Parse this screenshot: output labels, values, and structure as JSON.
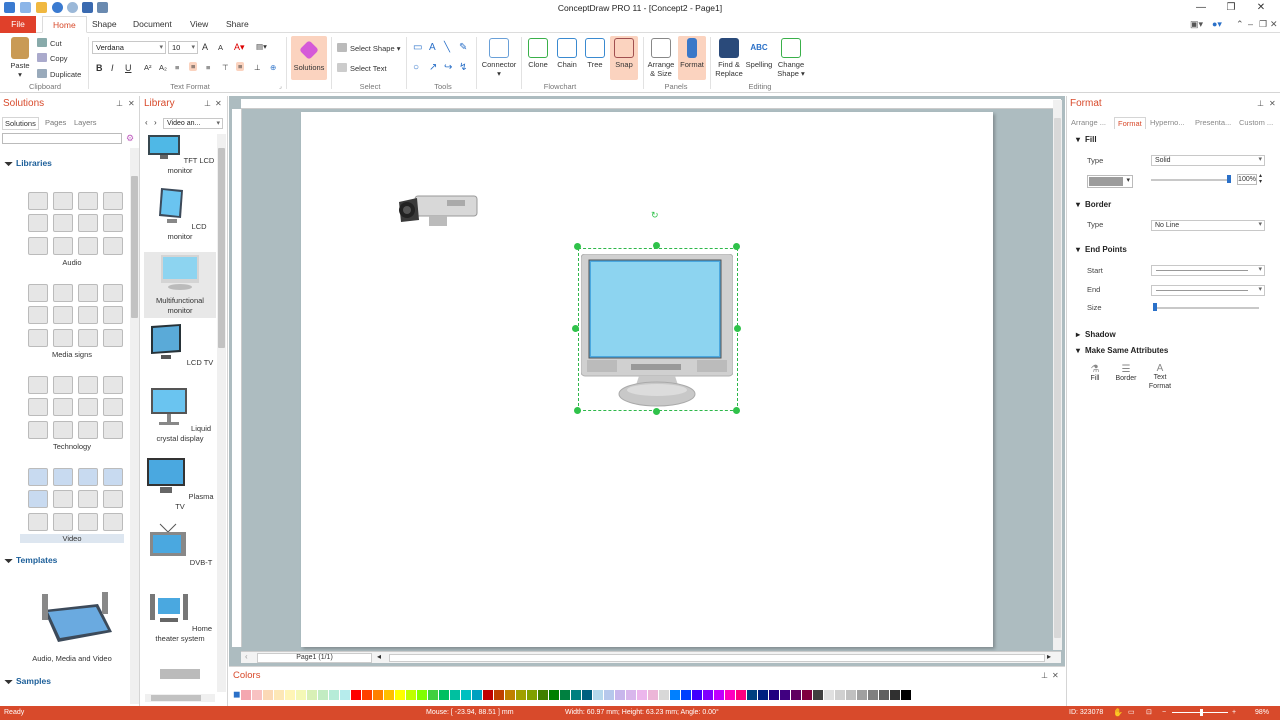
{
  "app": {
    "title": "ConceptDraw PRO 11 - [Concept2 - Page1]"
  },
  "menu": {
    "tabs": [
      "File",
      "Home",
      "Shape",
      "Document",
      "View",
      "Share"
    ]
  },
  "ribbon": {
    "clipboard": {
      "paste": "Paste",
      "cut": "Cut",
      "copy": "Copy",
      "duplicate": "Duplicate",
      "label": "Clipboard"
    },
    "text_format": {
      "font": "Verdana",
      "size": "10",
      "label": "Text Format",
      "bold": "B",
      "italic": "I",
      "underline": "U"
    },
    "solutions": {
      "label": "Solutions"
    },
    "select": {
      "select_shape": "Select Shape",
      "select_text": "Select Text",
      "label": "Select"
    },
    "tools": {
      "label": "Tools"
    },
    "connector": {
      "label": "Connector"
    },
    "flowchart": {
      "clone": "Clone",
      "chain": "Chain",
      "tree": "Tree",
      "snap": "Snap",
      "label": "Flowchart"
    },
    "panels": {
      "arrange": "Arrange & Size",
      "format": "Format",
      "label": "Panels"
    },
    "editing": {
      "find": "Find & Replace",
      "spelling": "Spelling",
      "change": "Change Shape",
      "label": "Editing"
    }
  },
  "solutions_panel": {
    "title": "Solutions",
    "tabs": [
      "Solutions",
      "Pages",
      "Layers"
    ],
    "libraries_heading": "Libraries",
    "libraries": [
      "Audio",
      "Media signs",
      "Technology",
      "Video"
    ],
    "templates_heading": "Templates",
    "template_name": "Audio, Media and Video",
    "samples_heading": "Samples"
  },
  "library_panel": {
    "title": "Library",
    "dropdown": "Video an...",
    "items": [
      {
        "label": "TFT LCD monitor"
      },
      {
        "label": "LCD monitor"
      },
      {
        "label": "Multifunctional monitor"
      },
      {
        "label": "LCD TV"
      },
      {
        "label": "Liquid crystal display"
      },
      {
        "label": "Plasma TV"
      },
      {
        "label": "DVB-T"
      },
      {
        "label": "Home theater system"
      }
    ]
  },
  "canvas": {
    "page_selector": "Page1 (1/1)"
  },
  "colors_panel": {
    "title": "Colors",
    "swatches": [
      "#f4a7b0",
      "#f8c2c2",
      "#fbd9b6",
      "#fde7b6",
      "#fff5b6",
      "#f4f8b6",
      "#d8f0b6",
      "#c2ecc2",
      "#b6ecd8",
      "#b6ecec",
      "#ff0000",
      "#ff4000",
      "#ff8000",
      "#ffbf00",
      "#ffff00",
      "#bfff00",
      "#80ff00",
      "#40d040",
      "#00c060",
      "#00c0a0",
      "#00c0c0",
      "#00a0c0",
      "#c00000",
      "#c04000",
      "#c08000",
      "#a0a000",
      "#80a000",
      "#408000",
      "#008000",
      "#008040",
      "#008080",
      "#006080",
      "#b6d8ec",
      "#b6c8ec",
      "#c8b6ec",
      "#d8b6ec",
      "#ecb6ec",
      "#ecb6d8",
      "#d8d8d8",
      "#0080ff",
      "#0040ff",
      "#4000ff",
      "#8000ff",
      "#c000ff",
      "#ff00c0",
      "#ff0080",
      "#004080",
      "#002080",
      "#200080",
      "#400080",
      "#600060",
      "#800040",
      "#404040",
      "#e0e0e0",
      "#d0d0d0",
      "#c0c0c0",
      "#a0a0a0",
      "#808080",
      "#606060",
      "#303030",
      "#000000",
      "#ffffff"
    ]
  },
  "format_panel": {
    "title": "Format",
    "tabs": [
      "Arrange ...",
      "Format",
      "Hyperno...",
      "Presenta...",
      "Custom ..."
    ],
    "fill_heading": "Fill",
    "fill_type_label": "Type",
    "fill_type": "Solid",
    "fill_color": "#9c9c9c",
    "opacity": "100%",
    "border_heading": "Border",
    "border_type_label": "Type",
    "border_type": "No Line",
    "endpoints_heading": "End Points",
    "start_label": "Start",
    "end_label": "End",
    "size_label": "Size",
    "shadow_heading": "Shadow",
    "make_same_heading": "Make Same Attributes",
    "make_same": [
      "Fill",
      "Border",
      "Text Format"
    ]
  },
  "status": {
    "ready": "Ready",
    "mouse": "Mouse: [ -23.94, 88.51 ] mm",
    "dims": "Width: 60.97 mm;  Height: 63.23 mm;  Angle: 0.00°",
    "id": "ID: 323078",
    "zoom": "98%"
  }
}
